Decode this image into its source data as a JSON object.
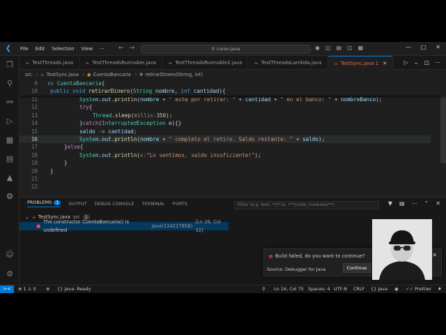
{
  "titlebar": {
    "menu": [
      "File",
      "Edit",
      "Selection",
      "View"
    ],
    "more": "···",
    "search": "curso-java"
  },
  "tabs": [
    {
      "label": "TestThreads.java"
    },
    {
      "label": "TestThreadsRunnable.java"
    },
    {
      "label": "TestThreadsRunnable2.java"
    },
    {
      "label": "TestThreadsLambda.java"
    },
    {
      "label": "TestSync.java",
      "suffix": "1",
      "active": true
    }
  ],
  "breadcrumb": {
    "folder": "src",
    "file": "TestSync.java",
    "class": "CuentaBancaria",
    "method": "retirarDinero(String, int)"
  },
  "editor": {
    "line_numbers": [
      "9",
      "10",
      "11",
      "12",
      "13",
      "14",
      "15",
      "16",
      "17",
      "18",
      "19",
      "20",
      "21",
      "22"
    ],
    "current_line": "16",
    "sticky_9": {
      "kw": "ss",
      "name": "CuentaBancaria",
      "rest": "{"
    },
    "sticky_10": {
      "kw1": "public",
      "kw2": "void",
      "fn": "retirarDinero",
      "p1t": "String",
      "p1": "nombre",
      "p2t": "int",
      "p2": "cantidad",
      "end": "){"
    },
    "l10_partial": "if(saldo >= cantidad){",
    "l11": {
      "cls": "System",
      "fld": "out",
      "fn": "println",
      "v1": "nombre",
      "s1": "\" esta por retirar: \"",
      "v2": "cantidad",
      "s2": "\" en el banco: \"",
      "v3": "nombreBanco",
      "end": ");"
    },
    "l12": {
      "kw": "try",
      "end": "{"
    },
    "l13": {
      "cls": "Thread",
      "fn": "sleep",
      "hint": "millis:",
      "num": "350",
      "end": ");"
    },
    "l14": {
      "pre": "}",
      "kw": "catch",
      "t": "InterruptedException",
      "v": "e",
      "end": "){}"
    },
    "l15": {
      "v1": "saldo",
      "op": " -= ",
      "v2": "cantidad",
      "end": ";"
    },
    "l16": {
      "cls": "System",
      "fld": "out",
      "fn": "println",
      "v1": "nombre",
      "s1": "\" completo el retiro. Saldo restante: \"",
      "v2": "saldo",
      "end": ");"
    },
    "l17": {
      "pre": "}",
      "kw": "else",
      "end": "{"
    },
    "l18": {
      "cls": "System",
      "fld": "out",
      "fn": "println",
      "hint": "x:",
      "s1": "\"Lo sentimos, saldo insuficiente!\"",
      "end": ");"
    },
    "l19": "}",
    "l21": "}"
  },
  "panel": {
    "tabs": [
      "PROBLEMS",
      "OUTPUT",
      "DEBUG CONSOLE",
      "TERMINAL",
      "PORTS"
    ],
    "problems_count": "1",
    "filter_placeholder": "Filter (e.g. text, **/*.ts, !**/node_modules/**)",
    "file_row": {
      "file": "TestSync.java",
      "folder": "src",
      "count": "1"
    },
    "error_row": {
      "message": "The constructor CuentaBancaria() is undefined",
      "source": "Java(134217858)",
      "location": "[Ln 26, Col 32]"
    }
  },
  "notification": {
    "message": "Build failed, do you want to continue?",
    "source": "Source: Debugger for Java",
    "button": "Continue"
  },
  "statusbar": {
    "remote": "><",
    "errors": "1",
    "warnings": "0",
    "java": "Java: Ready",
    "position": "Ln 16, Col 75",
    "spaces": "Spaces: 4",
    "encoding": "UTF-8",
    "eol": "CRLF",
    "language": "Java",
    "prettier": "Prettier"
  },
  "colors": {
    "accent": "#0078d4",
    "error": "#f14c4c",
    "java_icon": "#e8553a"
  }
}
